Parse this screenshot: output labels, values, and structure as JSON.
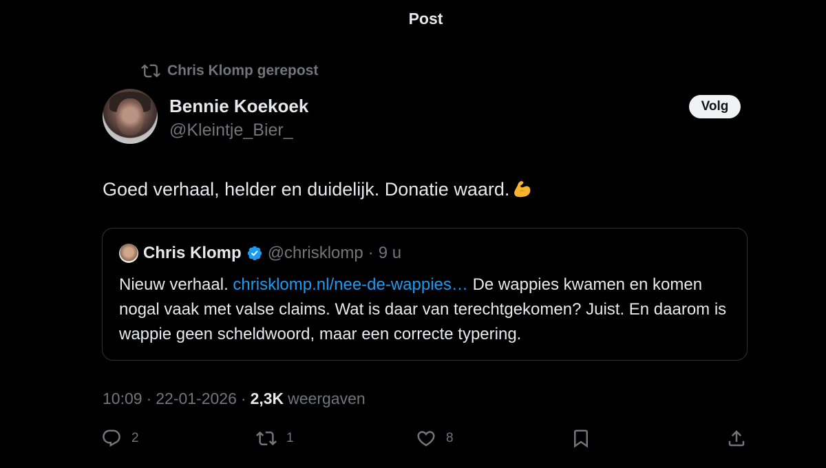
{
  "header": {
    "title": "Post"
  },
  "repost": {
    "icon": "repost-icon",
    "text": "Chris Klomp gerepost"
  },
  "author": {
    "name": "Bennie Koekoek",
    "handle": "@Kleintje_Bier_",
    "follow_label": "Volg"
  },
  "post": {
    "text": "Goed verhaal, helder en duidelijk. Donatie waard.",
    "emoji": "flexed-biceps-icon"
  },
  "quote": {
    "name": "Chris Klomp",
    "handle": "@chrisklomp",
    "separator": "·",
    "time": "9 u",
    "text_before": "Nieuw verhaal. ",
    "link": "chrisklomp.nl/nee-de-wappies…",
    "text_after": " De wappies kwamen en komen nogal vaak met valse claims. Wat is daar van terechtgekomen? Juist. En daarom is wappie geen scheldwoord, maar een correcte typering."
  },
  "meta": {
    "time": "10:09",
    "sep1": "·",
    "date": "22-01-2026",
    "sep2": "·",
    "views": "2,3K",
    "views_label": "weergaven"
  },
  "actions": {
    "replies": "2",
    "reposts": "1",
    "likes": "8"
  },
  "colors": {
    "background": "#000000",
    "text": "#e7e9ea",
    "muted": "#71767b",
    "link": "#1d9bf0",
    "border": "#2f3336"
  }
}
